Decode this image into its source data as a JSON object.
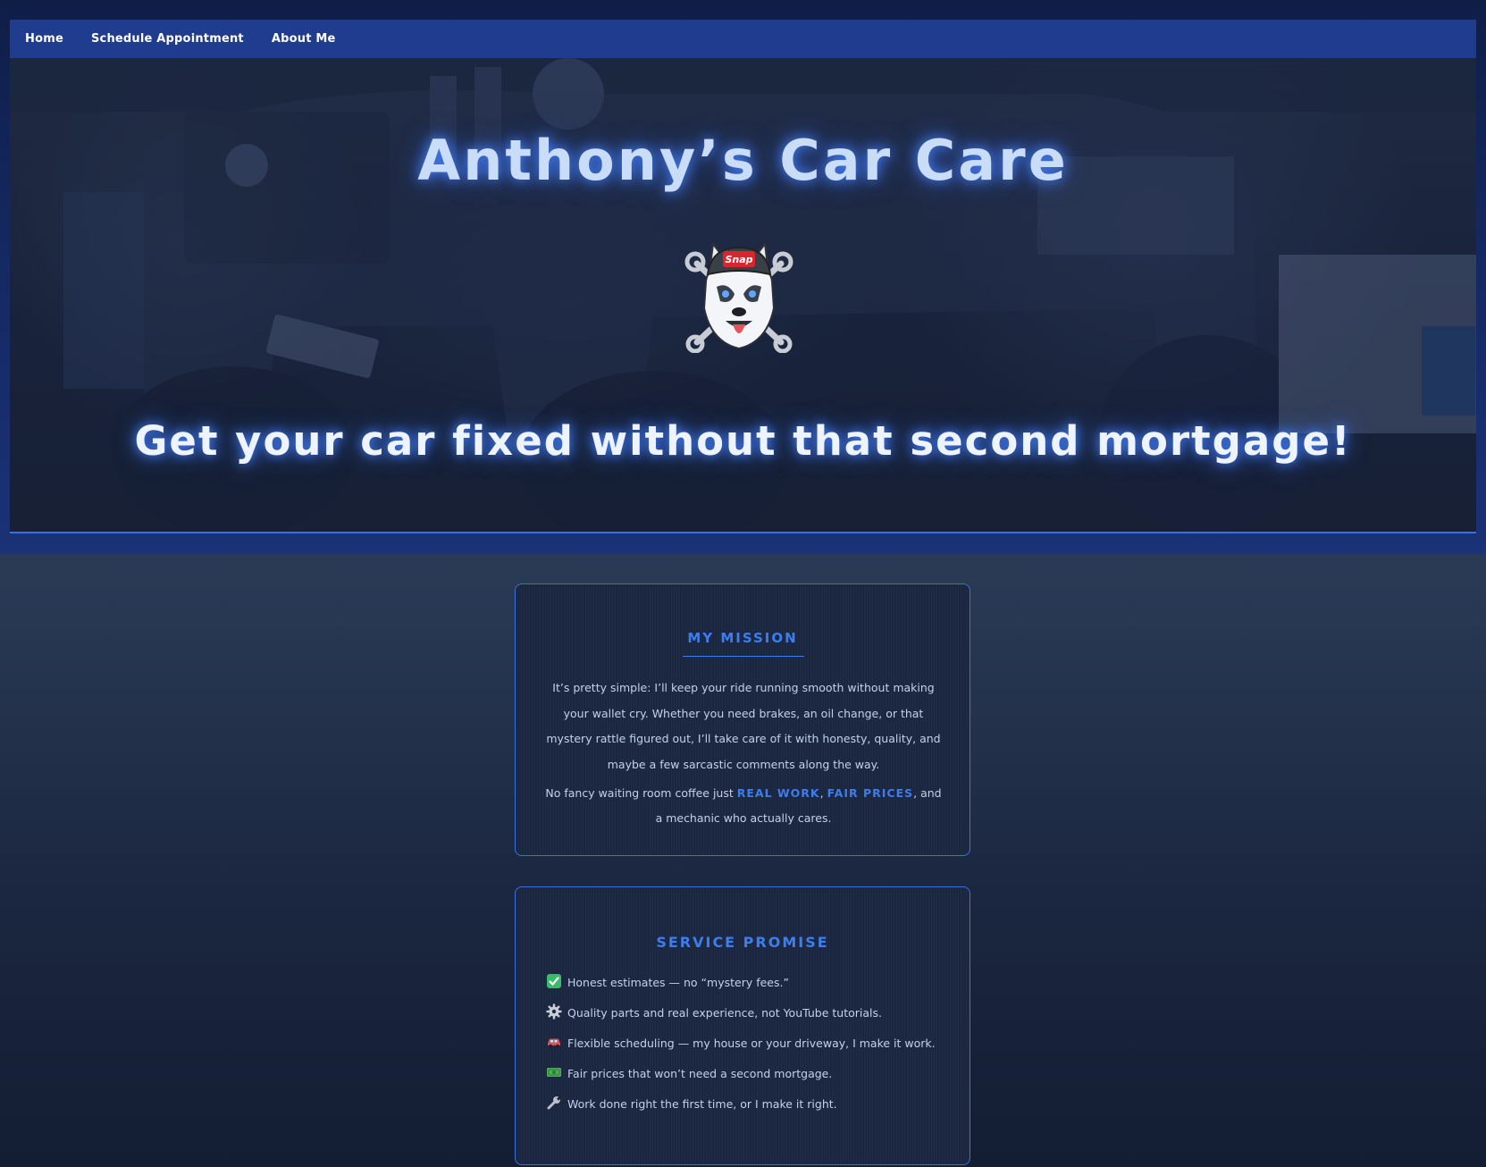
{
  "nav": {
    "items": [
      {
        "label": "Home"
      },
      {
        "label": "Schedule Appointment"
      },
      {
        "label": "About Me"
      }
    ]
  },
  "hero": {
    "title": "Anthony’s Car Care",
    "logo_icon": "husky-mechanic-logo",
    "logo_text": "Snap",
    "tagline": "Get your car fixed without that second mortgage!"
  },
  "mission": {
    "heading": "MY MISSION",
    "paragraph": "It’s pretty simple: I’ll keep your ride running smooth without making your wallet cry. Whether you need brakes, an oil change, or that mystery rattle figured out, I’ll take care of it with honesty, quality, and maybe a few sarcastic comments along the way.",
    "para2_prefix": "No fancy waiting room coffee just ",
    "para2_strong1": "REAL WORK",
    "para2_sep": ", ",
    "para2_strong2": "FAIR PRICES",
    "para2_suffix": ", and a mechanic who actually cares."
  },
  "promise": {
    "heading": "SERVICE PROMISE",
    "items": [
      {
        "icon": "check-icon",
        "text": "Honest estimates — no “mystery fees.”"
      },
      {
        "icon": "gear-icon",
        "text": "Quality parts and real experience, not YouTube tutorials."
      },
      {
        "icon": "car-icon",
        "text": "Flexible scheduling — my house or your driveway, I make it work."
      },
      {
        "icon": "money-icon",
        "text": "Fair prices that won’t need a second mortgage."
      },
      {
        "icon": "wrench-icon",
        "text": "Work done right the first time, or I make it right."
      }
    ]
  },
  "colors": {
    "nav_bg": "#1f3c8f",
    "accent": "#3c7df0",
    "title_text": "#c9dcf8",
    "body_text": "#c2d2ec",
    "card_bg": "#1b2640"
  }
}
